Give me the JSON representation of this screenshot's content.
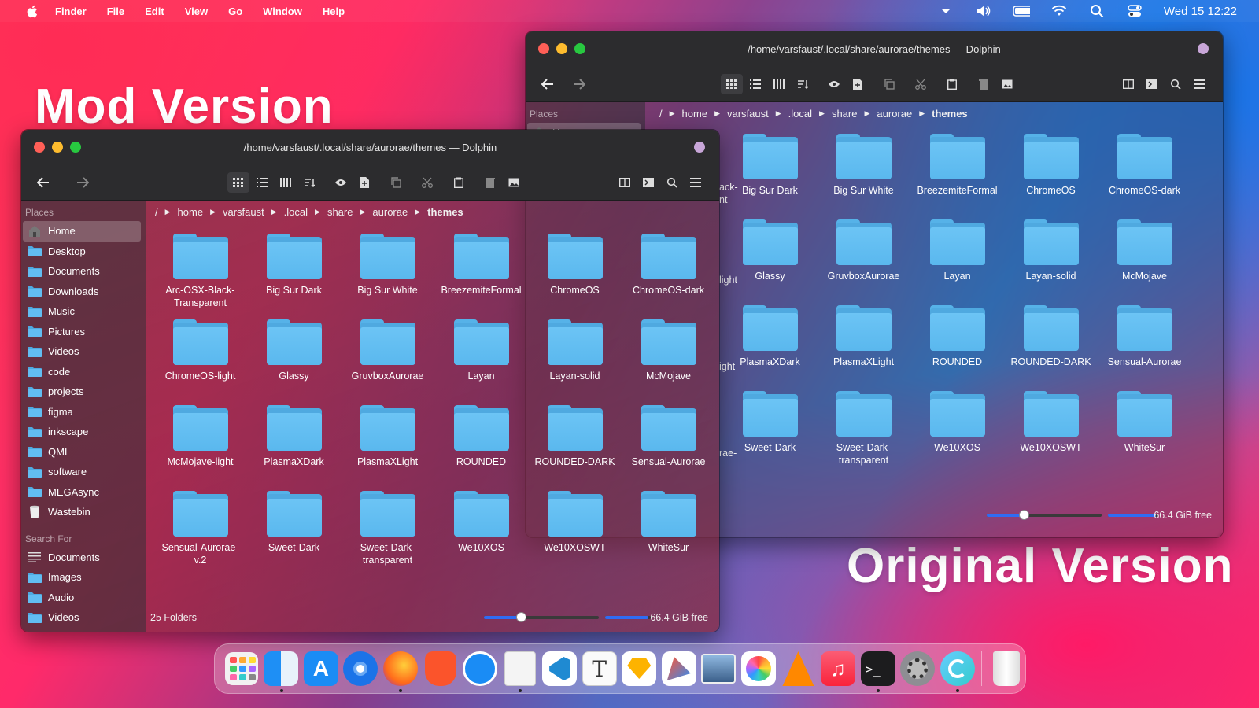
{
  "menubar": {
    "app": "Finder",
    "items": [
      "File",
      "Edit",
      "View",
      "Go",
      "Window",
      "Help"
    ],
    "clock": "Wed 15  12:22"
  },
  "labels": {
    "mod": "Mod Version",
    "original": "Original Version"
  },
  "window_title": "/home/varsfaust/.local/share/aurorae/themes — Dolphin",
  "sidebar": {
    "places_header": "Places",
    "places": [
      "Home",
      "Desktop",
      "Documents",
      "Downloads",
      "Music",
      "Pictures",
      "Videos",
      "code",
      "projects",
      "figma",
      "inkscape",
      "QML",
      "software",
      "MEGAsync",
      "Wastebin"
    ],
    "search_header": "Search For",
    "search": [
      "Documents",
      "Images",
      "Audio",
      "Videos"
    ]
  },
  "breadcrumb": [
    "/",
    "home",
    "varsfaust",
    ".local",
    "share",
    "aurorae",
    "themes"
  ],
  "folders": [
    "Arc-OSX-Black-Transparent",
    "Big Sur Dark",
    "Big Sur White",
    "BreezemiteFormal",
    "ChromeOS",
    "ChromeOS-dark",
    "ChromeOS-light",
    "Glassy",
    "GruvboxAurorae",
    "Layan",
    "Layan-solid",
    "McMojave",
    "McMojave-light",
    "PlasmaXDark",
    "PlasmaXLight",
    "ROUNDED",
    "ROUNDED-DARK",
    "Sensual-Aurorae",
    "Sensual-Aurorae-v.2",
    "Sweet-Dark",
    "Sweet-Dark-transparent",
    "We10XOS",
    "We10XOSWT",
    "WhiteSur"
  ],
  "original_folders": [
    "Big Sur Dark",
    "Big Sur White",
    "BreezemiteFormal",
    "ChromeOS",
    "ChromeOS-dark",
    "Glassy",
    "GruvboxAurorae",
    "Layan",
    "Layan-solid",
    "McMojave",
    "PlasmaXDark",
    "PlasmaXLight",
    "ROUNDED",
    "ROUNDED-DARK",
    "Sensual-Aurorae",
    "Sweet-Dark",
    "Sweet-Dark-transparent",
    "We10XOS",
    "We10XOSWT",
    "WhiteSur"
  ],
  "original_partial_labels": [
    "ack-\nnt",
    "light",
    "ight",
    "rae-"
  ],
  "status": {
    "count": "25 Folders",
    "free": "66.4 GiB free",
    "zoom_fraction": 0.32,
    "disk_used_fraction": 0.95
  },
  "colors": {
    "accent": "#2f6cf3",
    "folder": "#5ab8ee",
    "titlebar": "#2c2c2e"
  },
  "dock": [
    "launchpad-icon",
    "finder-icon",
    "app-store-icon",
    "chromium-icon",
    "firefox-icon",
    "brave-icon",
    "safari-icon",
    "text-editor-icon",
    "vscode-icon",
    "typora-icon",
    "sketch-icon",
    "pen-tool-icon",
    "preview-icon",
    "photos-icon",
    "vlc-icon",
    "music-icon",
    "terminal-icon",
    "system-preferences-icon",
    "aurora-icon",
    "trash-icon"
  ]
}
